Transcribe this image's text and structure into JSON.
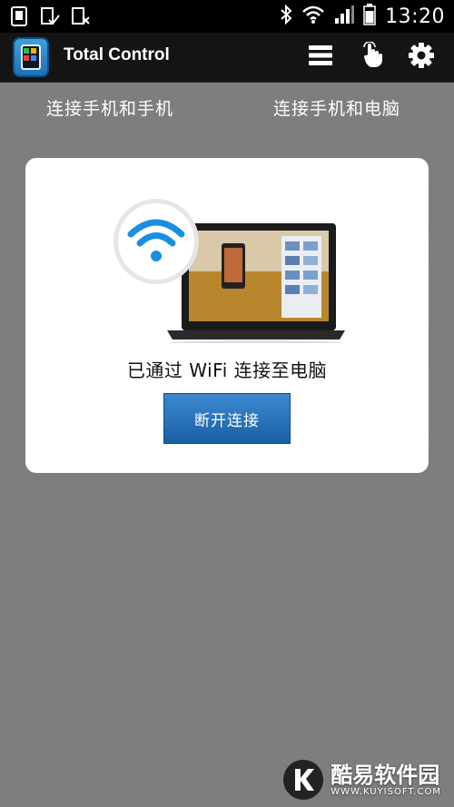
{
  "status_bar": {
    "time": "13:20",
    "icons_left": [
      "sim-card-icon",
      "clipboard-check-icon",
      "sim-off-icon"
    ],
    "icons_right": [
      "bluetooth-icon",
      "wifi-signal-icon",
      "cell-signal-icon",
      "battery-icon"
    ]
  },
  "app_bar": {
    "title": "Total Control",
    "actions": [
      "menu-icon",
      "touch-hand-icon",
      "settings-gear-icon"
    ]
  },
  "tabs": [
    {
      "label": "连接手机和手机"
    },
    {
      "label": "连接手机和电脑"
    }
  ],
  "card": {
    "status_text": "已通过 WiFi 连接至电脑",
    "button_label": "断开连接"
  },
  "watermark": {
    "cn": "酷易软件园",
    "en": "WWW.KUYISOFT.COM"
  },
  "colors": {
    "accent": "#2b78c2",
    "wifi_blue": "#1a8fe0",
    "background": "#7b7b7b"
  }
}
